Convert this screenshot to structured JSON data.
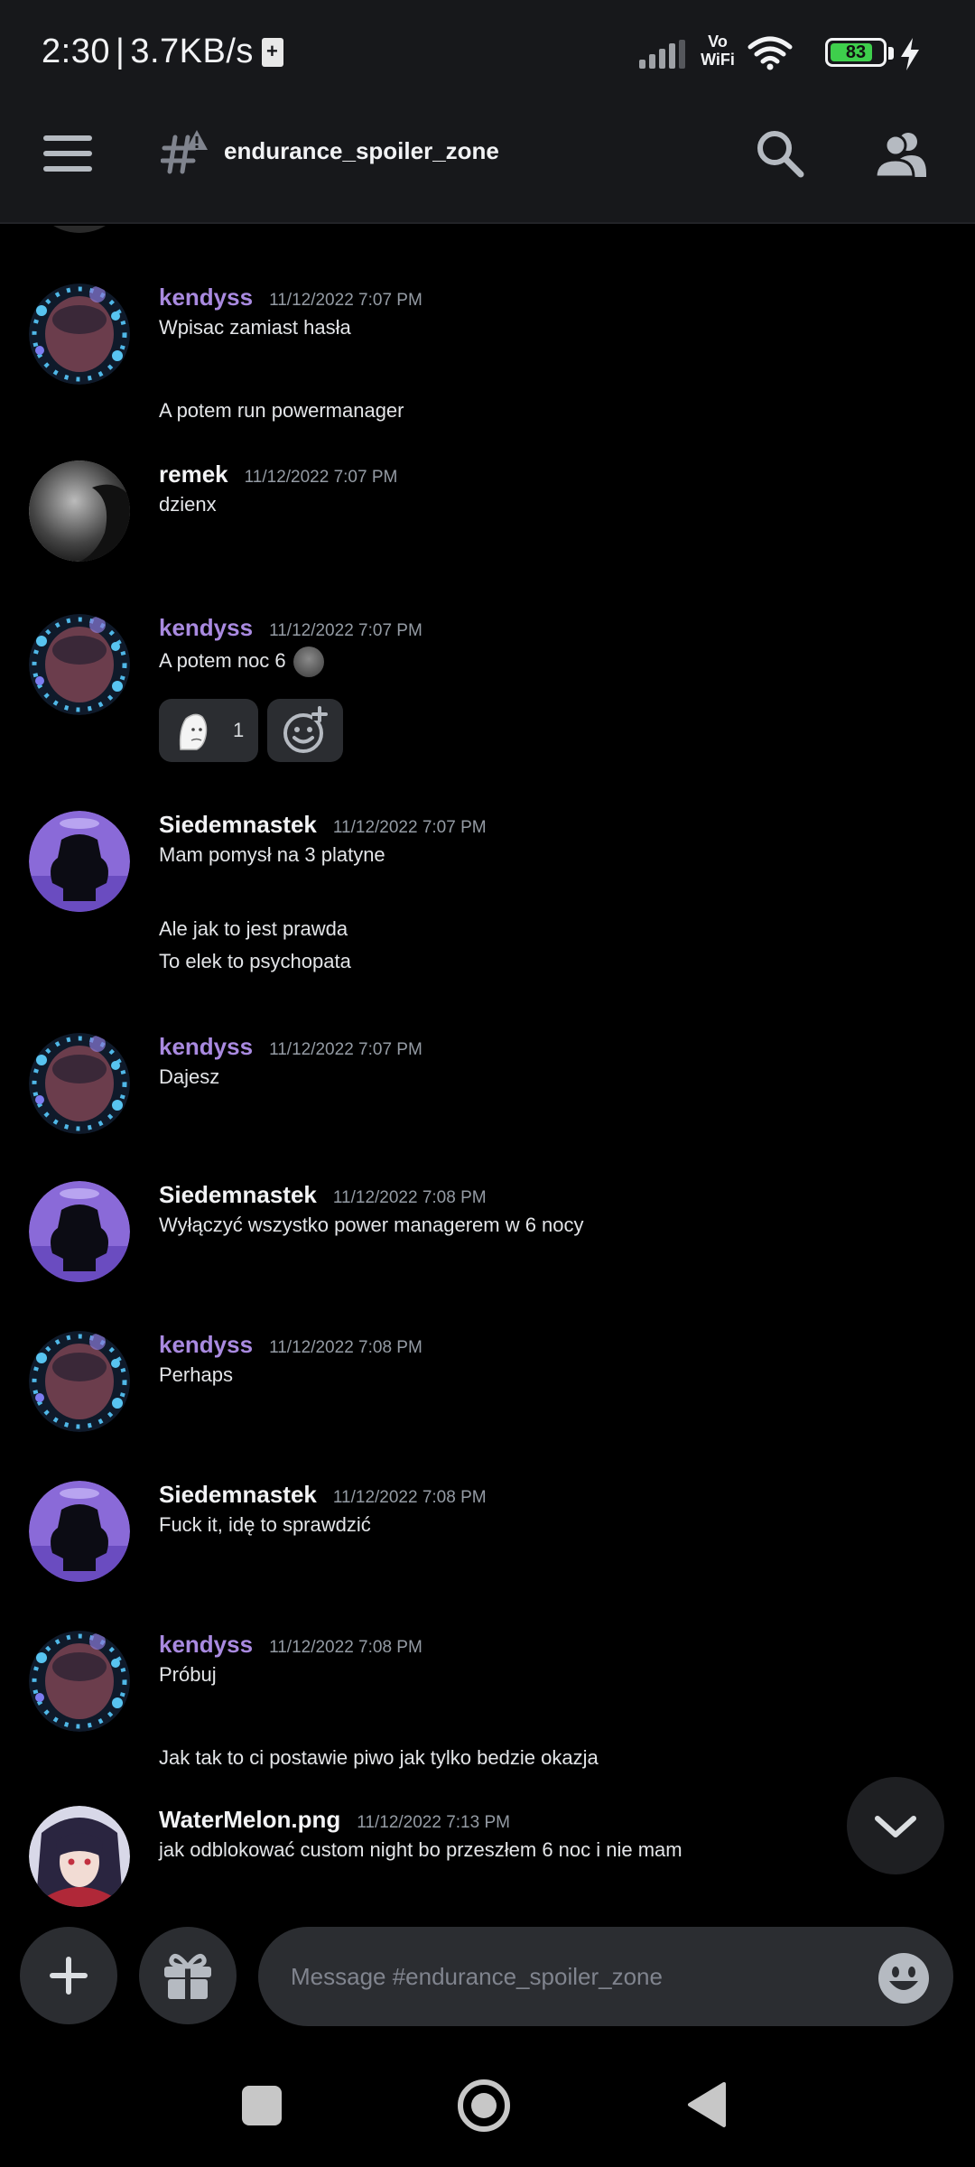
{
  "status_bar": {
    "time": "2:30",
    "separator": "|",
    "speed": "3.7KB/s",
    "vowifi_line1": "Vo",
    "vowifi_line2": "WiFi",
    "battery_level": "83",
    "battery_fraction": 0.83
  },
  "header": {
    "channel_name": "endurance_spoiler_zone",
    "menu_icon": "hamburger-menu-icon",
    "channel_icon": "thread-warning-icon",
    "search_icon": "search-icon",
    "members_icon": "members-icon"
  },
  "colors": {
    "background": "#000000",
    "header_bg": "#17181b",
    "author_purple": "#a98ae0",
    "bubble_bg": "#2b2d31",
    "battery_green": "#3ecf4c"
  },
  "messages": [
    {
      "author": "kendyss",
      "timestamp": "11/12/2022 7:07 PM",
      "lines": [
        "Wpisac zamiast hasła"
      ],
      "continuation": [
        "A potem run powermanager"
      ]
    },
    {
      "author": "remek",
      "timestamp": "11/12/2022 7:07 PM",
      "lines": [
        "dzienx"
      ]
    },
    {
      "author": "kendyss",
      "timestamp": "11/12/2022 7:07 PM",
      "lines": [
        "A potem noc 6"
      ],
      "reaction_count": "1"
    },
    {
      "author": "Siedemnastek",
      "timestamp": "11/12/2022 7:07 PM",
      "lines": [
        "Mam pomysł na 3 platyne"
      ],
      "continuation": [
        "Ale jak to jest prawda",
        "To elek to psychopata"
      ]
    },
    {
      "author": "kendyss",
      "timestamp": "11/12/2022 7:07 PM",
      "lines": [
        "Dajesz"
      ]
    },
    {
      "author": "Siedemnastek",
      "timestamp": "11/12/2022 7:08 PM",
      "lines": [
        "Wyłączyć wszystko power managerem w 6 nocy"
      ]
    },
    {
      "author": "kendyss",
      "timestamp": "11/12/2022 7:08 PM",
      "lines": [
        "Perhaps"
      ]
    },
    {
      "author": "Siedemnastek",
      "timestamp": "11/12/2022 7:08 PM",
      "lines": [
        "Fuck it, idę to sprawdzić"
      ]
    },
    {
      "author": "kendyss",
      "timestamp": "11/12/2022 7:08 PM",
      "lines": [
        "Próbuj"
      ],
      "continuation": [
        "Jak tak to ci postawie piwo jak tylko bedzie okazja"
      ]
    },
    {
      "author": "WaterMelon.png",
      "timestamp": "11/12/2022 7:13 PM",
      "lines": [
        "jak odblokować custom night bo przeszłem 6 noc i nie mam"
      ]
    }
  ],
  "composer": {
    "placeholder": "Message #endurance_spoiler_zone"
  }
}
